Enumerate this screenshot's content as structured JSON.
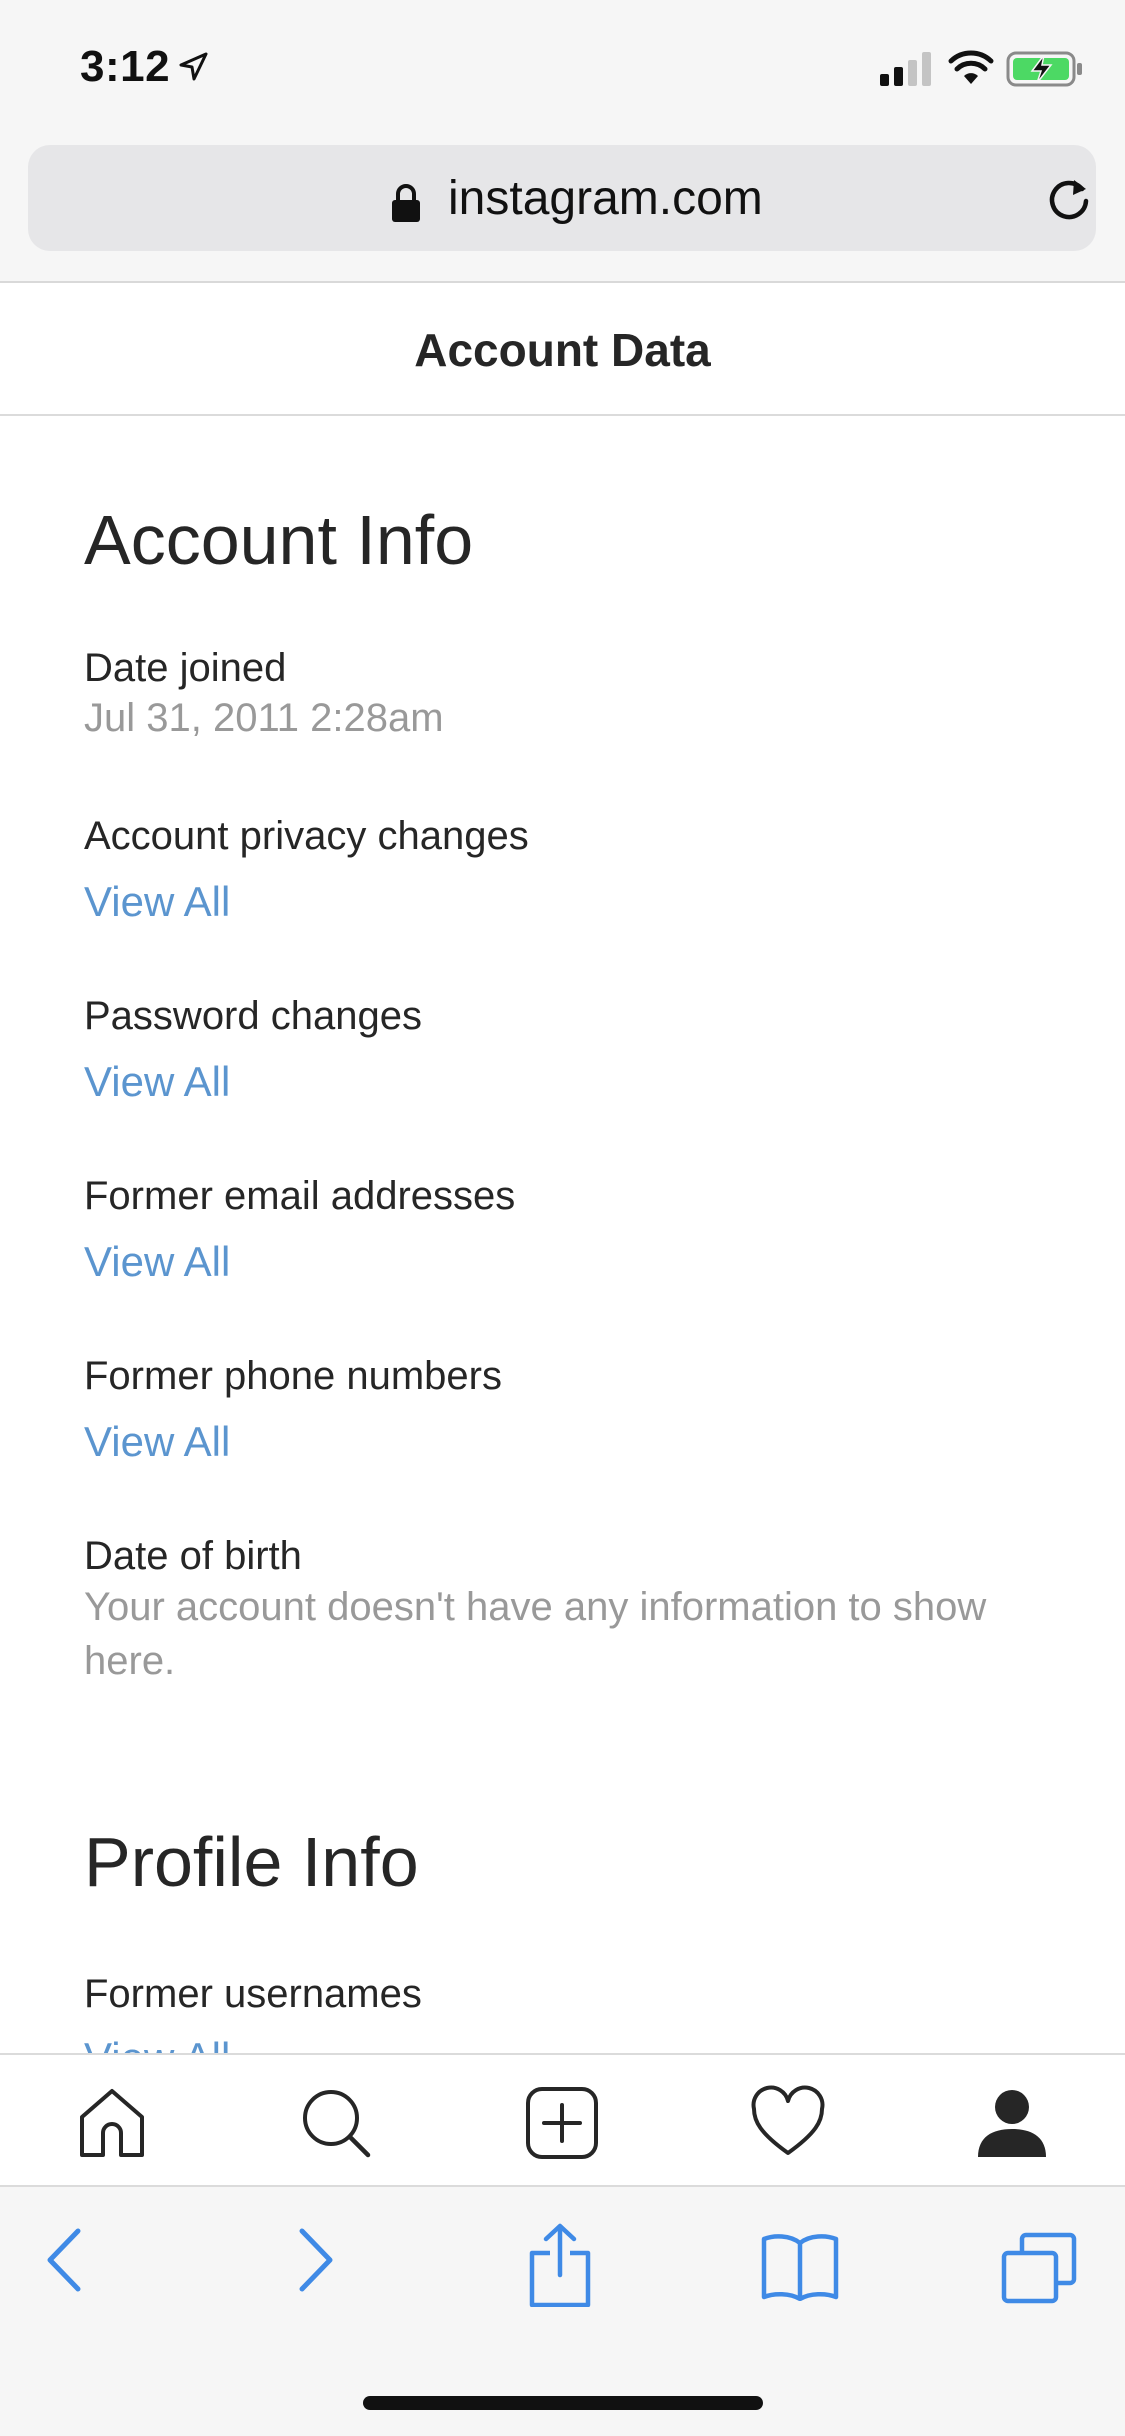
{
  "status_bar": {
    "time": "3:12"
  },
  "browser": {
    "url": "instagram.com"
  },
  "header": {
    "title": "Account Data"
  },
  "sections": {
    "account_info": {
      "title": "Account Info",
      "date_joined_label": "Date joined",
      "date_joined_value": "Jul 31, 2011 2:28am",
      "privacy_label": "Account privacy changes",
      "privacy_link": "View All",
      "password_label": "Password changes",
      "password_link": "View All",
      "email_label": "Former email addresses",
      "email_link": "View All",
      "phone_label": "Former phone numbers",
      "phone_link": "View All",
      "dob_label": "Date of birth",
      "dob_value": "Your account doesn't have any information to show here."
    },
    "profile_info": {
      "title": "Profile Info",
      "usernames_label": "Former usernames",
      "usernames_link": "View All"
    }
  },
  "ig_tabbar": {
    "icons": [
      "home-icon",
      "search-icon",
      "new-post-icon",
      "activity-heart-icon",
      "profile-icon"
    ]
  },
  "safari_toolbar": {
    "icons": [
      "back-chevron-icon",
      "forward-chevron-icon",
      "share-icon",
      "bookmarks-icon",
      "tabs-icon"
    ]
  },
  "colors": {
    "link": "#5b95cf",
    "muted": "#999999",
    "text": "#262626"
  }
}
